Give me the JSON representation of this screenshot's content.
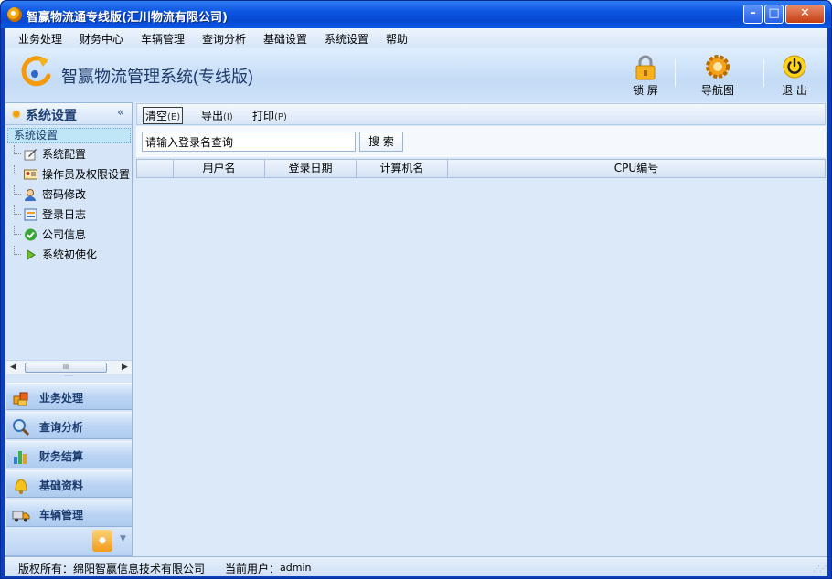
{
  "window": {
    "title": "智赢物流通专线版(汇川物流有限公司)",
    "min_label": "–",
    "max_label": "□",
    "close_label": "✕"
  },
  "menu": [
    "业务处理",
    "财务中心",
    "车辆管理",
    "查询分析",
    "基础设置",
    "系统设置",
    "帮助"
  ],
  "banner": {
    "app_name": "智赢物流管理系统(专线版)",
    "buttons": [
      {
        "label": "锁 屏",
        "icon": "lock-icon"
      },
      {
        "label": "导航图",
        "icon": "gear-icon"
      },
      {
        "label": "退 出",
        "icon": "power-icon"
      }
    ]
  },
  "sidebar": {
    "title": "系统设置",
    "collapse_glyph": "«",
    "tree_root": "系统设置",
    "items": [
      {
        "label": "系统配置",
        "icon": "pencil-paper-icon"
      },
      {
        "label": "操作员及权限设置",
        "icon": "id-card-icon"
      },
      {
        "label": "密码修改",
        "icon": "user-key-icon"
      },
      {
        "label": "登录日志",
        "icon": "log-icon"
      },
      {
        "label": "公司信息",
        "icon": "check-circle-icon"
      },
      {
        "label": "系统初使化",
        "icon": "play-arrow-icon"
      }
    ],
    "scroll_thumb_glyph": "III",
    "nav_buttons": [
      {
        "label": "业务处理",
        "icon": "boxes-icon"
      },
      {
        "label": "查询分析",
        "icon": "magnifier-icon"
      },
      {
        "label": "财务结算",
        "icon": "bar-chart-icon"
      },
      {
        "label": "基础资料",
        "icon": "bell-icon"
      },
      {
        "label": "车辆管理",
        "icon": "truck-icon"
      }
    ]
  },
  "toolbar": {
    "clear_label": "清空",
    "clear_key": "(E)",
    "export_label": "导出",
    "export_key": "(I)",
    "print_label": "打印",
    "print_key": "(P)"
  },
  "search": {
    "placeholder": "请输入登录名查询",
    "button_label": "搜 索"
  },
  "grid": {
    "columns": [
      "",
      "用户名",
      "登录日期",
      "计算机名",
      "CPU编号"
    ]
  },
  "status": {
    "copyright": "版权所有：绵阳智赢信息技术有限公司",
    "current_user_label": "当前用户：",
    "current_user": "admin"
  },
  "colors": {
    "titlebar": "#0a55e0",
    "accent_orange": "#f3a100",
    "panel_blue": "#dbe8f8"
  }
}
